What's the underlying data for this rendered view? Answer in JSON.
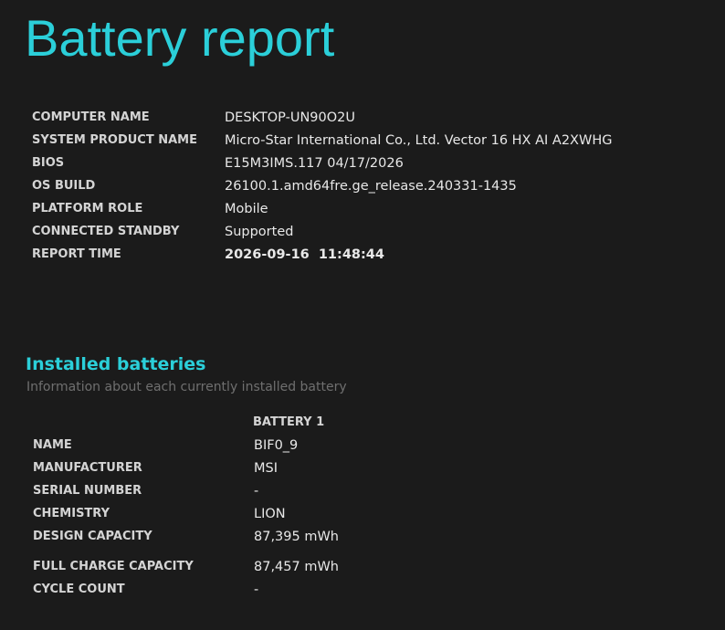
{
  "report": {
    "title": "Battery report",
    "system_info": [
      {
        "label": "COMPUTER NAME",
        "value": "DESKTOP-UN90O2U"
      },
      {
        "label": "SYSTEM PRODUCT NAME",
        "value": "Micro-Star International Co., Ltd. Vector 16 HX AI A2XWHG"
      },
      {
        "label": "BIOS",
        "value": "E15M3IMS.117 04/17/2026"
      },
      {
        "label": "OS BUILD",
        "value": "26100.1.amd64fre.ge_release.240331-1435"
      },
      {
        "label": "PLATFORM ROLE",
        "value": "Mobile"
      },
      {
        "label": "CONNECTED STANDBY",
        "value": "Supported"
      },
      {
        "label": "REPORT TIME",
        "value": "2026-09-16  11:48:44"
      }
    ]
  },
  "installed_batteries": {
    "title": "Installed batteries",
    "subtitle": "Information about each currently installed battery",
    "column_header": "BATTERY 1",
    "rows": [
      {
        "label": "NAME",
        "value": "BIF0_9"
      },
      {
        "label": "MANUFACTURER",
        "value": "MSI"
      },
      {
        "label": "SERIAL NUMBER",
        "value": "-"
      },
      {
        "label": "CHEMISTRY",
        "value": "LION"
      },
      {
        "label": "DESIGN CAPACITY",
        "value": "87,395 mWh"
      },
      {
        "label": "FULL CHARGE CAPACITY",
        "value": "87,457 mWh"
      },
      {
        "label": "CYCLE COUNT",
        "value": "-"
      }
    ]
  },
  "colors": {
    "background": "#1b1b1b",
    "accent": "#2bcfd9",
    "text": "#e8e8e8",
    "subtle": "#6f6f6f"
  }
}
